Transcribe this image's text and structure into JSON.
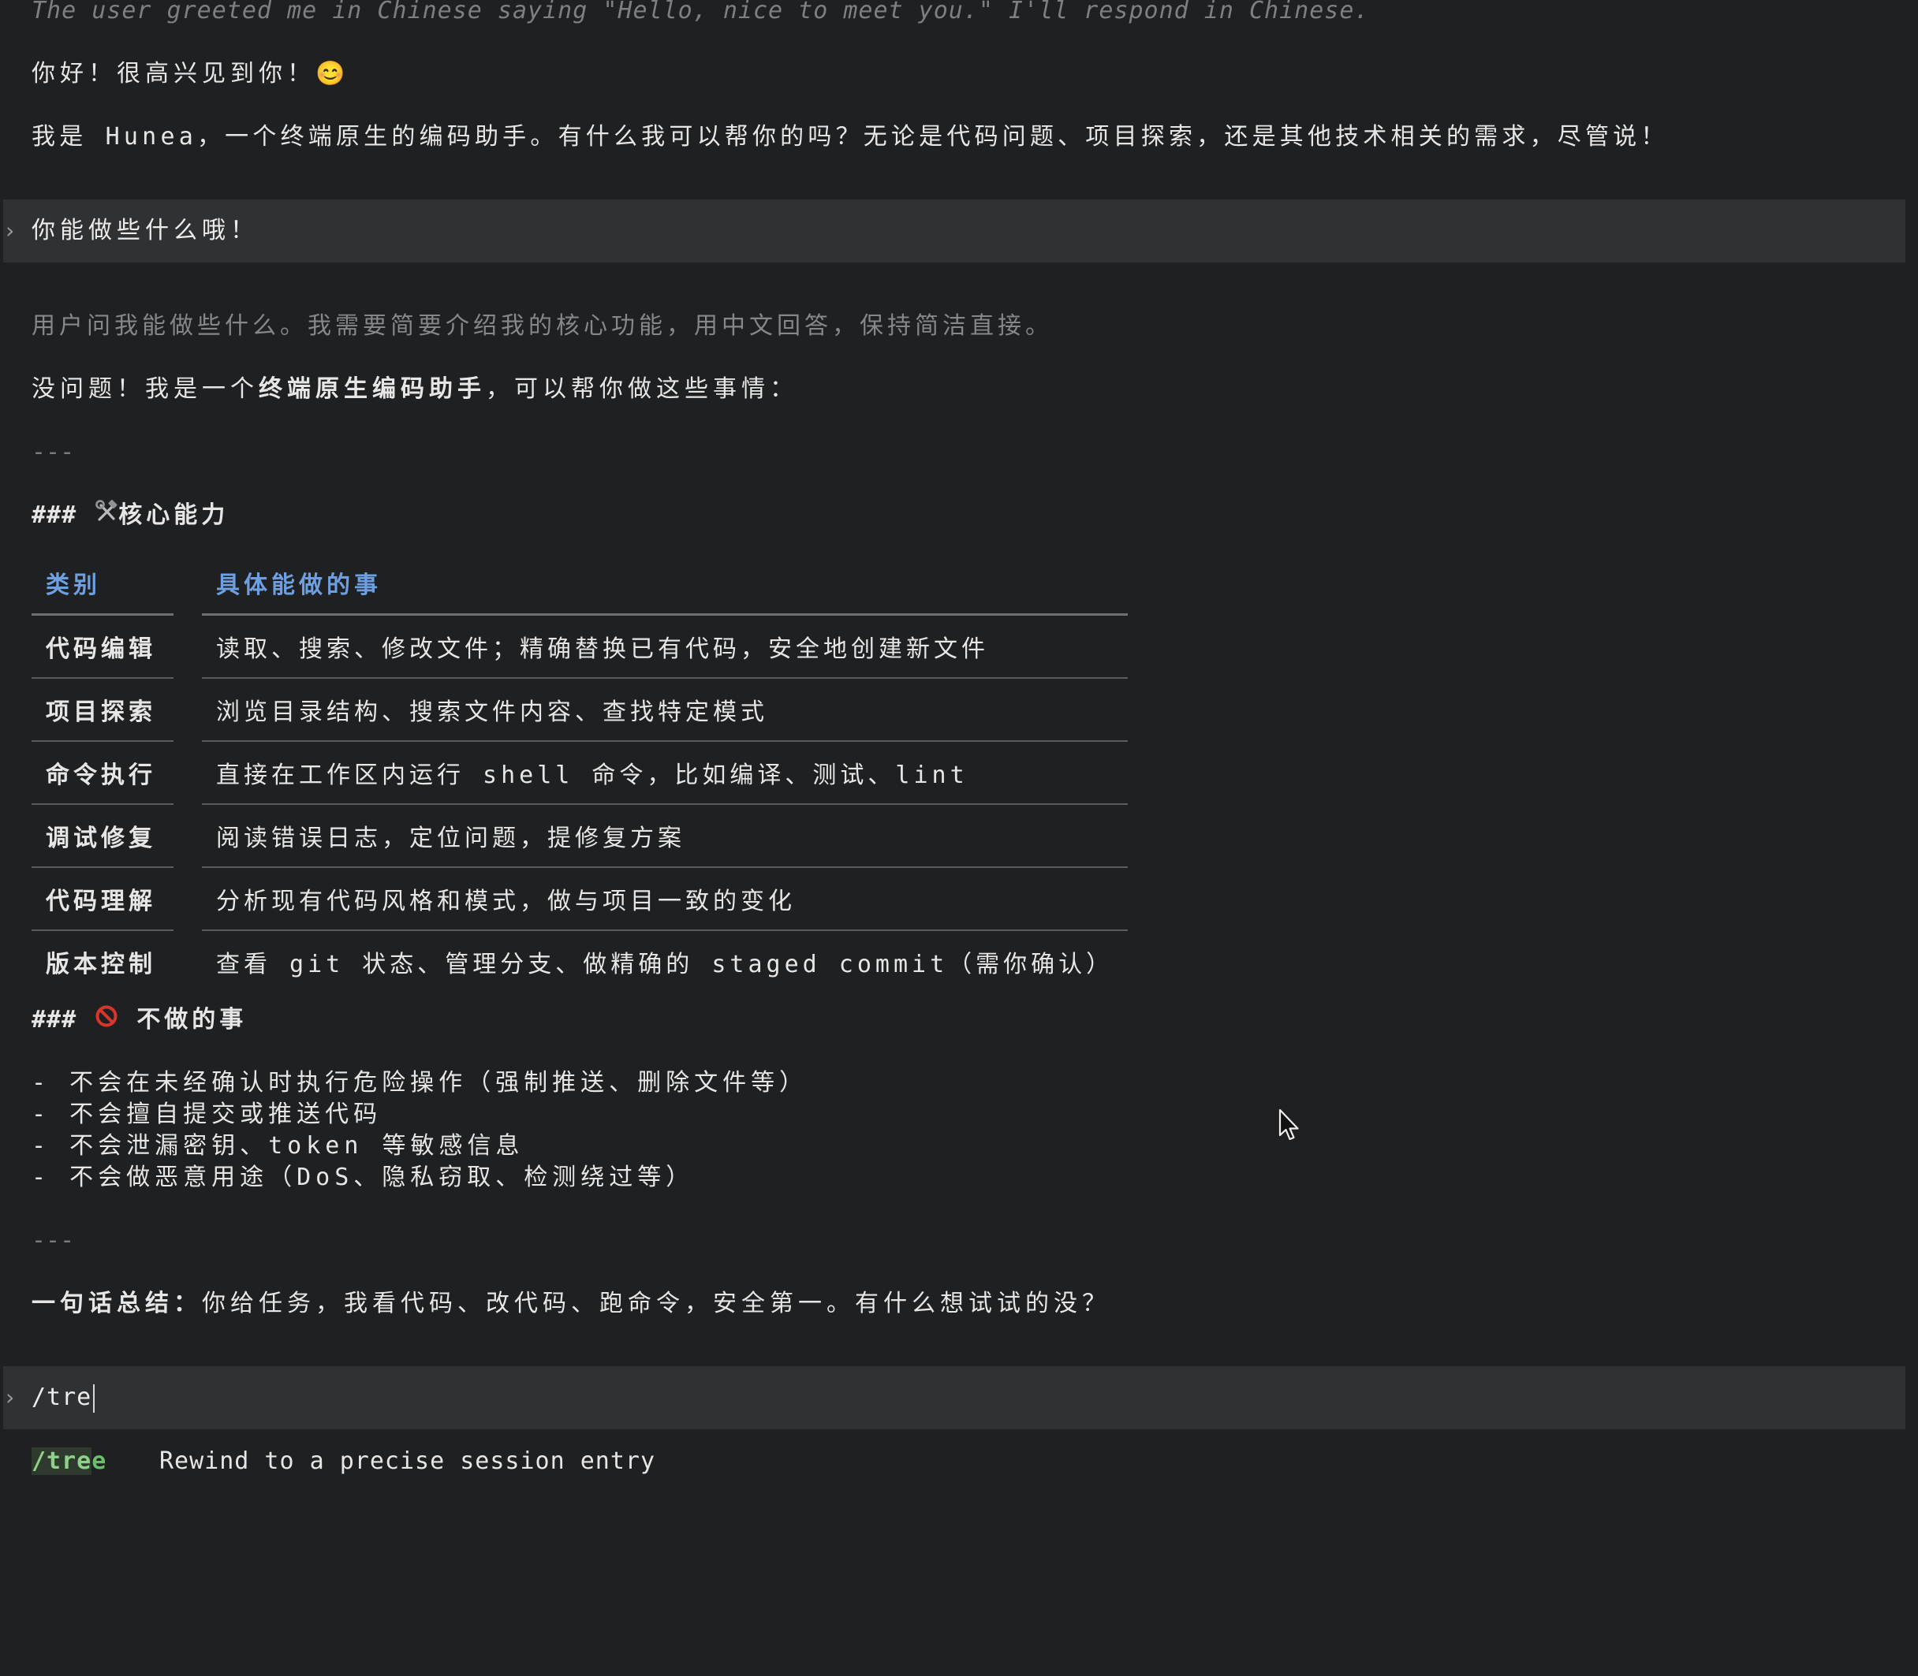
{
  "conversation": {
    "thinking_1": "The user greeted me in Chinese saying \"Hello, nice to meet you.\" I'll respond in Chinese.",
    "reply_1_line1": "你好！很高兴见到你！😊",
    "reply_1_line2": "我是 Hunea，一个终端原生的编码助手。有什么我可以帮你的吗？无论是代码问题、项目探索，还是其他技术相关的需求，尽管说！",
    "user_message_2": "你能做些什么哦！",
    "thinking_2": "用户问我能做些什么。我需要简要介绍我的核心功能，用中文回答，保持简洁直接。",
    "reply_2_intro_prefix": "没问题！我是一个",
    "reply_2_intro_bold": "终端原生编码助手",
    "reply_2_intro_suffix": "，可以帮你做这些事情：",
    "hr_1": "---",
    "section_1_hash": "###",
    "section_1_title": "核心能力",
    "table": {
      "headers": [
        "类别",
        "具体能做的事"
      ],
      "rows": [
        {
          "category": "代码编辑",
          "desc": "读取、搜索、修改文件；精确替换已有代码，安全地创建新文件"
        },
        {
          "category": "项目探索",
          "desc": "浏览目录结构、搜索文件内容、查找特定模式"
        },
        {
          "category": "命令执行",
          "desc": "直接在工作区内运行 shell 命令，比如编译、测试、lint"
        },
        {
          "category": "调试修复",
          "desc": "阅读错误日志，定位问题，提修复方案"
        },
        {
          "category": "代码理解",
          "desc": "分析现有代码风格和模式，做与项目一致的变化"
        },
        {
          "category": "版本控制",
          "desc": "查看 git 状态、管理分支、做精确的 staged commit（需你确认）"
        }
      ]
    },
    "section_2_hash": "###",
    "section_2_title": "不做的事",
    "donts": [
      "- 不会在未经确认时执行危险操作（强制推送、删除文件等）",
      "- 不会擅自提交或推送代码",
      "- 不会泄漏密钥、token 等敏感信息",
      "- 不会做恶意用途（DoS、隐私窃取、检测绕过等）"
    ],
    "hr_2": "---",
    "summary_label": "一句话总结：",
    "summary_text": "你给任务，我看代码、改代码、跑命令，安全第一。有什么想试试的没？"
  },
  "input": {
    "marker": "›",
    "value": "/tre"
  },
  "autocomplete": {
    "command_match": "/tre",
    "command_rest": "e",
    "description": "Rewind to a precise session entry"
  },
  "icons": {
    "tools": "hammer-wrench-icon",
    "prohibited": "prohibited-icon",
    "smile": "smiling-face-icon",
    "cursor": "mouse-pointer-icon"
  },
  "colors": {
    "background": "#1f2021",
    "prompt_bar": "#303132",
    "table_header": "#6e9fe0",
    "command_green": "#6cbf6a",
    "prohibited_red": "#d9362b"
  }
}
